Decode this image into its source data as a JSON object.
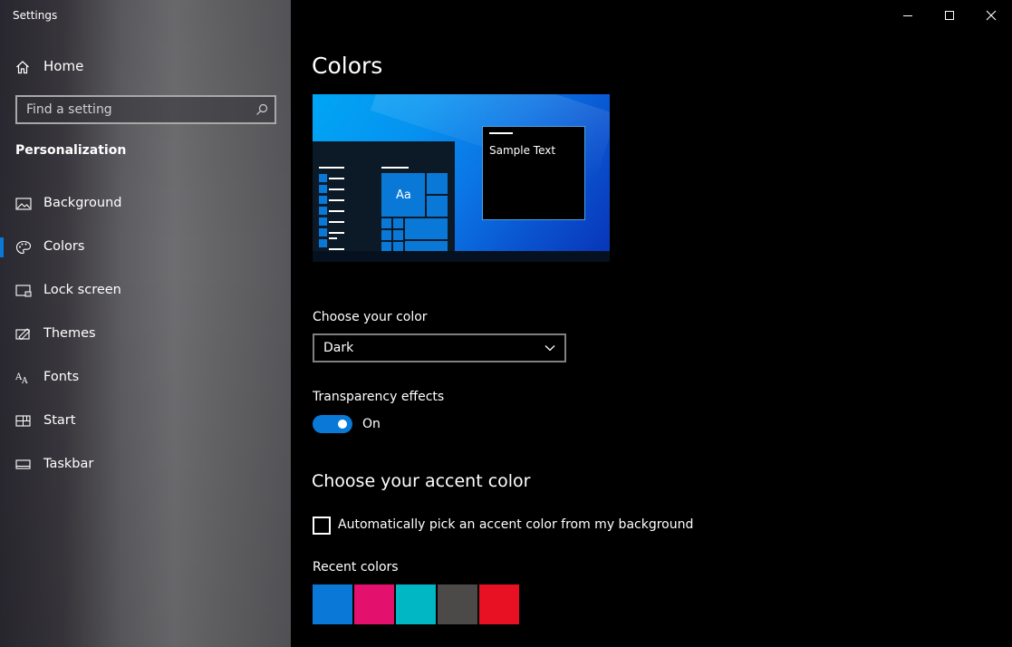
{
  "window": {
    "title": "Settings",
    "controls": [
      "minimize-icon",
      "maximize-icon",
      "close-icon"
    ]
  },
  "sidebar": {
    "home_label": "Home",
    "home_icon": "home-icon",
    "search": {
      "placeholder": "Find a setting",
      "value": "",
      "icon": "search-icon"
    },
    "section_title": "Personalization",
    "items": [
      {
        "label": "Background",
        "icon": "picture-icon",
        "selected": false
      },
      {
        "label": "Colors",
        "icon": "palette-icon",
        "selected": true
      },
      {
        "label": "Lock screen",
        "icon": "lock-screen-icon",
        "selected": false
      },
      {
        "label": "Themes",
        "icon": "themes-icon",
        "selected": false
      },
      {
        "label": "Fonts",
        "icon": "fonts-icon",
        "selected": false
      },
      {
        "label": "Start",
        "icon": "start-icon",
        "selected": false
      },
      {
        "label": "Taskbar",
        "icon": "taskbar-icon",
        "selected": false
      }
    ]
  },
  "main": {
    "title": "Colors",
    "preview": {
      "sample_text": "Sample Text",
      "tile_text": "Aa"
    },
    "choose_color": {
      "label": "Choose your color",
      "selected": "Dark"
    },
    "transparency": {
      "label": "Transparency effects",
      "state_label": "On",
      "on": true
    },
    "accent": {
      "heading": "Choose your accent color",
      "auto_pick_label": "Automatically pick an accent color from my background",
      "auto_pick_checked": false,
      "recent_label": "Recent colors",
      "recent_colors": [
        "#0a78d6",
        "#e3106e",
        "#00b7c3",
        "#4c4a48",
        "#e81123"
      ]
    }
  },
  "colors": {
    "accent": "#0a78d6",
    "background": "#000000"
  }
}
